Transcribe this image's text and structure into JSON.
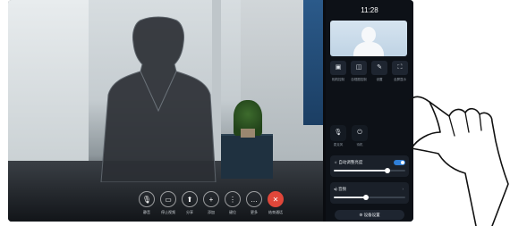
{
  "clock": {
    "time": "11:28"
  },
  "toolbar": {
    "items": [
      {
        "label": "静音",
        "icon": "microphone-icon",
        "glyph": "🎙"
      },
      {
        "label": "停止视频",
        "icon": "camera-icon",
        "glyph": "▭"
      },
      {
        "label": "分享",
        "icon": "share-icon",
        "glyph": "⬆"
      },
      {
        "label": "添加",
        "icon": "add-icon",
        "glyph": "+"
      },
      {
        "label": "键位",
        "icon": "keypad-icon",
        "glyph": "⋮"
      },
      {
        "label": "更多",
        "icon": "more-icon",
        "glyph": "…"
      },
      {
        "label": "结束通话",
        "icon": "end-call-icon",
        "glyph": "✕"
      }
    ],
    "end_color": "#e0473a"
  },
  "quick_controls": [
    {
      "label": "相机控制",
      "icon": "camera-control-icon",
      "glyph": "▣"
    },
    {
      "label": "自视图控制",
      "icon": "selfview-icon",
      "glyph": "◫"
    },
    {
      "label": "设置",
      "icon": "settings-icon",
      "glyph": "✎"
    },
    {
      "label": "全屏显示",
      "icon": "fullscreen-icon",
      "glyph": "⛶"
    }
  ],
  "mid_controls": [
    {
      "label": "麦克风",
      "icon": "microphone-icon",
      "glyph": "🎙"
    },
    {
      "label": "待机",
      "icon": "standby-icon",
      "glyph": "⏻"
    }
  ],
  "brightness_card": {
    "label": "自动调整亮度",
    "toggle_on": true,
    "level": 0.75
  },
  "volume_card": {
    "label": "音频",
    "level": 0.45
  },
  "settings_button": {
    "label": "设备设置",
    "icon": "gear-icon",
    "glyph": "⚙"
  },
  "colors": {
    "accent": "#2f7fd8",
    "panel_bg": "#0d1117"
  }
}
